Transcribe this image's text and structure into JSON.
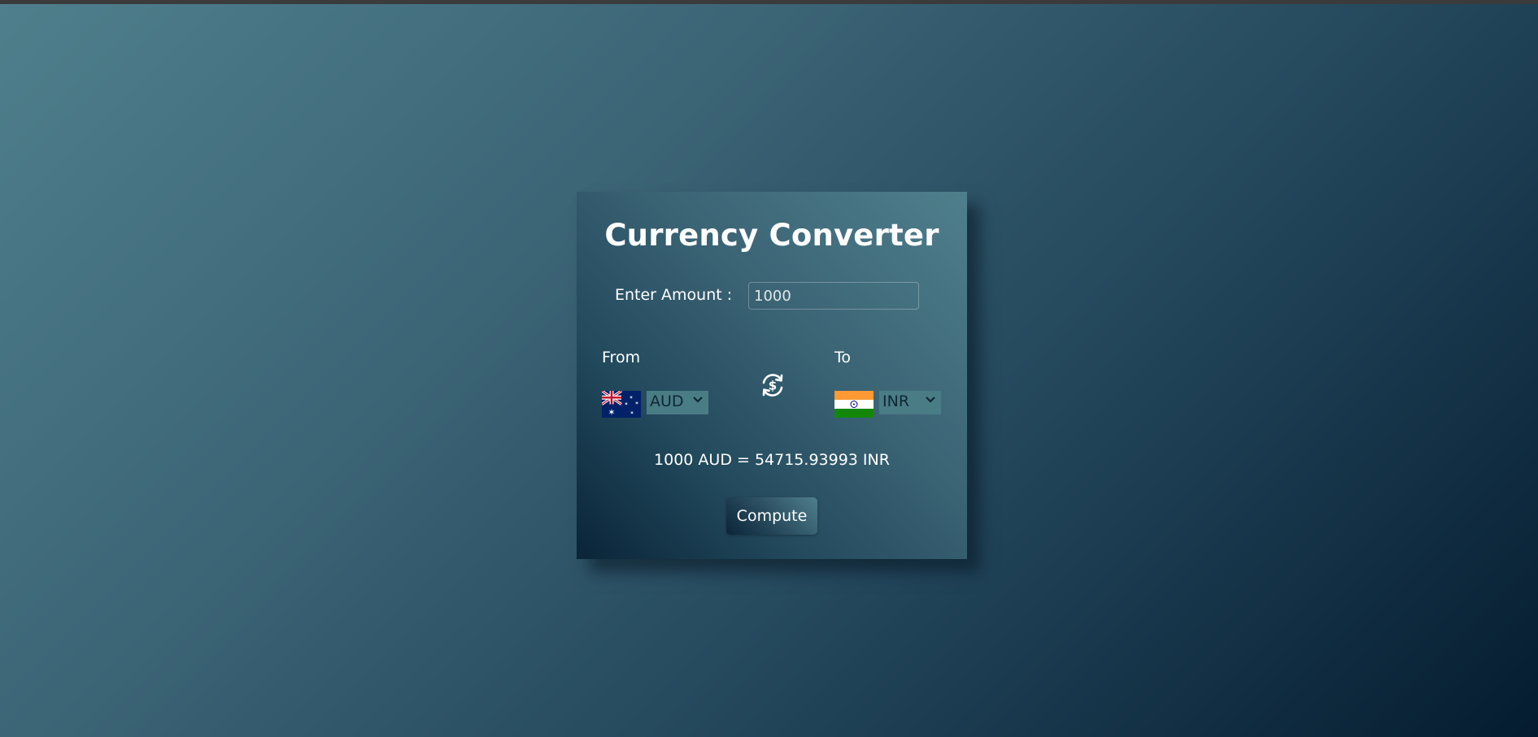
{
  "app": {
    "title": "Currency Converter"
  },
  "amount": {
    "label": "Enter Amount :",
    "value": "1000"
  },
  "from": {
    "label": "From",
    "currency": "AUD",
    "flag_icon": "australia-flag-icon"
  },
  "to": {
    "label": "To",
    "currency": "INR",
    "flag_icon": "india-flag-icon"
  },
  "swap": {
    "icon": "currency-exchange-icon"
  },
  "result": {
    "text": "1000 AUD = 54715.93993 INR"
  },
  "actions": {
    "compute_label": "Compute"
  },
  "colors": {
    "background_light": "#4f7f8c",
    "background_dark": "#051c30",
    "select_background": "#4a7c86",
    "text": "#ffffff"
  }
}
